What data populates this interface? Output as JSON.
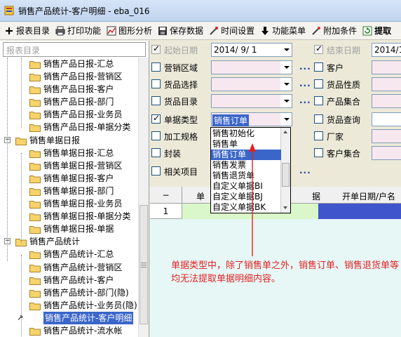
{
  "window": {
    "title": "销售产品统计-客户明细 - eba_016"
  },
  "toolbar": {
    "items": [
      {
        "label": "报表目录",
        "icon": "plus-icon"
      },
      {
        "label": "打印功能",
        "icon": "printer-icon"
      },
      {
        "label": "图形分析",
        "icon": "chart-icon"
      },
      {
        "label": "保存数据",
        "icon": "save-icon"
      },
      {
        "label": "时间设置",
        "icon": "tools-icon"
      },
      {
        "label": "功能菜单",
        "icon": "arrow-down-icon"
      },
      {
        "label": "附加条件",
        "icon": "wand-icon"
      },
      {
        "label": "提取",
        "icon": "refresh-icon"
      }
    ]
  },
  "tree": {
    "header": "报表目录",
    "rows": [
      {
        "label": "销售产品日报-汇总",
        "level": 2
      },
      {
        "label": "销售产品日报-营销区",
        "level": 2
      },
      {
        "label": "销售产品日报-客户",
        "level": 2
      },
      {
        "label": "销售产品日报-部门",
        "level": 2
      },
      {
        "label": "销售产品日报-业务员",
        "level": 2
      },
      {
        "label": "销售产品日报-单据分类",
        "level": 2
      },
      {
        "label": "销售单据日报",
        "level": 1,
        "expander": "−"
      },
      {
        "label": "销售单据日报-汇总",
        "level": 2
      },
      {
        "label": "销售单据日报-营销区",
        "level": 2
      },
      {
        "label": "销售单据日报-客户",
        "level": 2
      },
      {
        "label": "销售单据日报-部门",
        "level": 2
      },
      {
        "label": "销售单据日报-业务员",
        "level": 2
      },
      {
        "label": "销售单据日报-单据分类",
        "level": 2
      },
      {
        "label": "销售单据日报-单据",
        "level": 2
      },
      {
        "label": "销售产品统计",
        "level": 1,
        "expander": "−"
      },
      {
        "label": "销售产品统计-汇总",
        "level": 2
      },
      {
        "label": "销售产品统计-营销区",
        "level": 2
      },
      {
        "label": "销售产品统计-客户",
        "level": 2
      },
      {
        "label": "销售产品统计-部门(隐)",
        "level": 2
      },
      {
        "label": "销售产品统计-业务员(隐)",
        "level": 2
      },
      {
        "label": "销售产品统计-客户明细",
        "level": 2,
        "selected": true
      },
      {
        "label": "销售产品统计-流水帐",
        "level": 2
      }
    ]
  },
  "form": {
    "start_date": {
      "label": "起始日期",
      "value": "2014/  9/  1",
      "checked": true,
      "disabled": true
    },
    "end_date": {
      "label": "结束日期",
      "value": "2014/1",
      "checked": true,
      "disabled": true
    },
    "left_rows": [
      {
        "label": "营销区域",
        "checked": false
      },
      {
        "label": "货品选择",
        "checked": false
      },
      {
        "label": "货品目录",
        "checked": false
      },
      {
        "label": "单据类型",
        "checked": true,
        "value": "销售订单"
      },
      {
        "label": "加工规格",
        "checked": false
      },
      {
        "label": "封装",
        "checked": false
      },
      {
        "label": "相关项目",
        "checked": false
      }
    ],
    "right_rows": [
      {
        "label": "客户"
      },
      {
        "label": "货品性质"
      },
      {
        "label": "产品集合"
      },
      {
        "label": "货品查询"
      },
      {
        "label": "厂家"
      },
      {
        "label": "客户集合"
      }
    ],
    "ellipsis": "..."
  },
  "dropdown": {
    "options": [
      "销售初始化",
      "销售单",
      "销售订单",
      "销售发票",
      "销售退货单",
      "自定义单据BI",
      "自定义单据BJ",
      "自定义单据BK"
    ],
    "selected": "销售订单"
  },
  "grid": {
    "corner": "−",
    "col1": "单",
    "col2": "据",
    "col3": "开单日期/户名",
    "row_number": "1"
  },
  "annotation": {
    "text": "单据类型中，除了销售单之外，销售订单、销售退货单等均无法提取单据明细内容。",
    "color": "#e32222"
  }
}
